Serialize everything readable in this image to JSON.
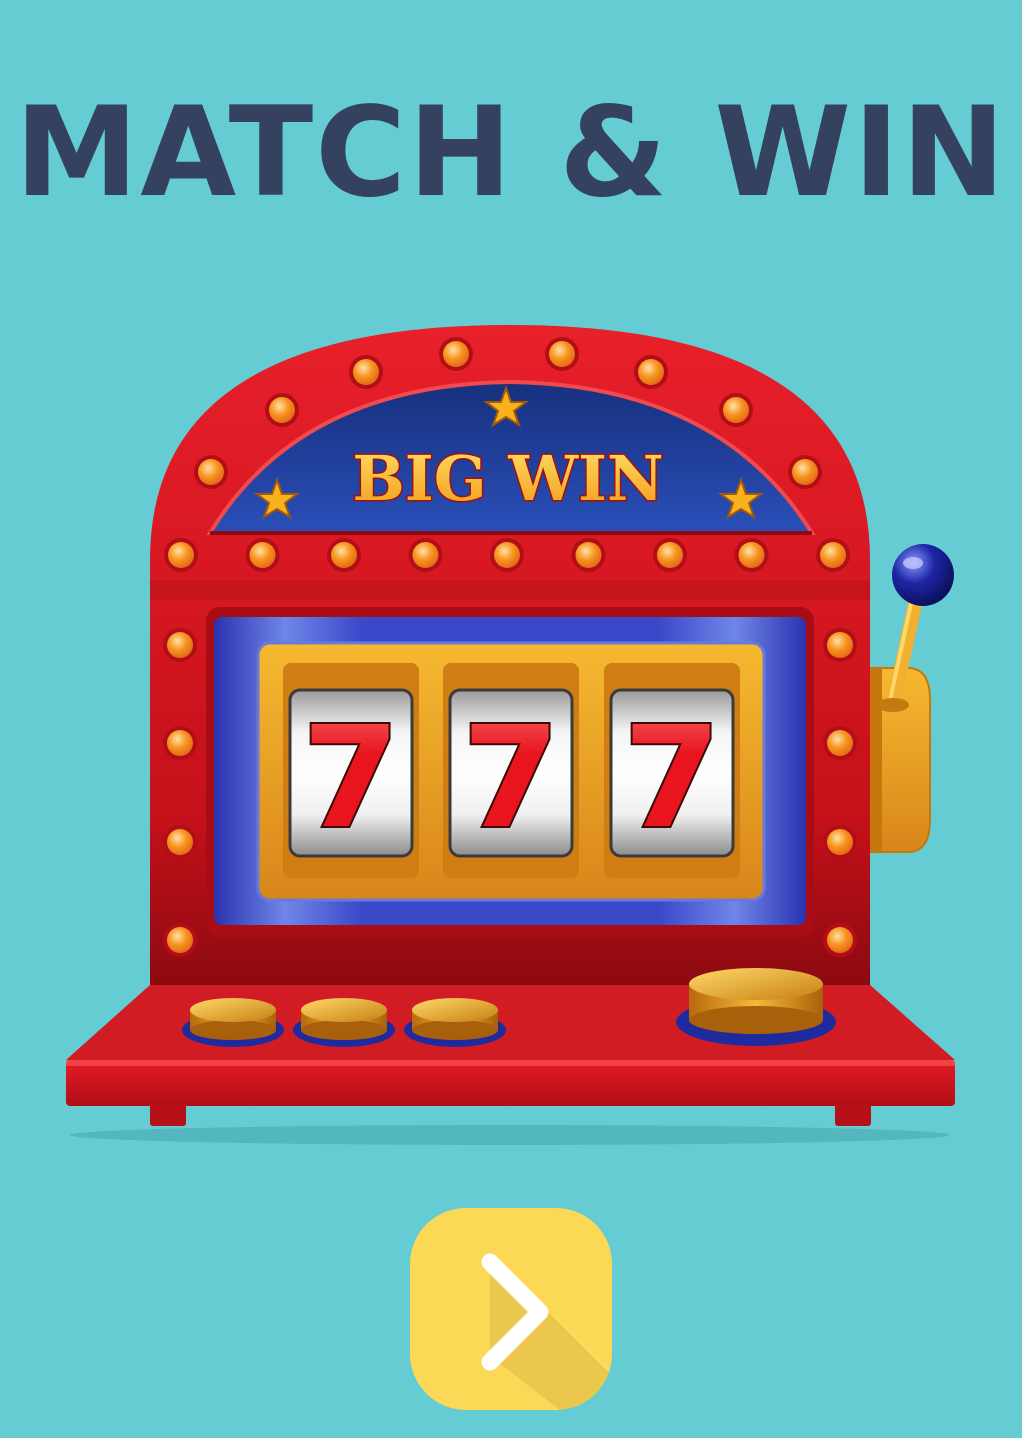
{
  "title": "MATCH & WIN",
  "slot_machine": {
    "marquee_text": "BIG WIN",
    "reels": [
      "7",
      "7",
      "7"
    ]
  },
  "next_button": {
    "icon": "chevron-right-icon"
  },
  "colors": {
    "background": "#66ccd3",
    "title": "#34425f",
    "machine_red": "#d8141c",
    "marquee_blue": "#1e3a8f",
    "gold": "#f2a71d",
    "button_yellow": "#fbd957"
  }
}
